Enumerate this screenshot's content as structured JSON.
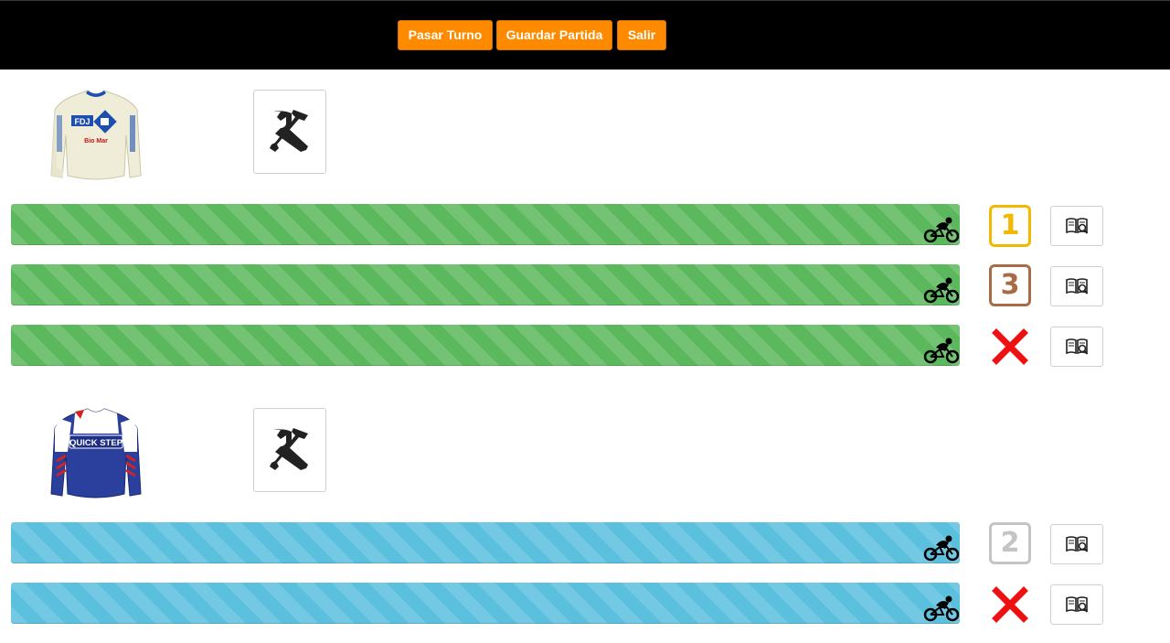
{
  "toolbar": {
    "buttons": [
      "Pasar Turno",
      "Guardar Partida",
      "Salir"
    ],
    "button_color": "#ff8a00"
  },
  "teams": [
    {
      "jersey_icon": "team-jersey-fdj",
      "jersey_text": [
        "FDJ",
        "Bio Mar"
      ],
      "progress_color": "#5cb85c",
      "riders": [
        {
          "progress": 1.0,
          "result": "1",
          "result_color": "#f5b800"
        },
        {
          "progress": 1.0,
          "result": "3",
          "result_color": "#a86b46"
        },
        {
          "progress": 1.0,
          "result": "abandoned",
          "result_color": "#ee1111"
        }
      ]
    },
    {
      "jersey_icon": "team-jersey-quickstep",
      "jersey_text": [
        "QUICK STEP"
      ],
      "progress_color": "#5bc0de",
      "riders": [
        {
          "progress": 1.0,
          "result": "2",
          "result_color": "#c4c4c4"
        },
        {
          "progress": 1.0,
          "result": "abandoned",
          "result_color": "#ee1111"
        }
      ]
    }
  ],
  "icons": {
    "tools": "hammer-wrench-icon",
    "bike": "cyclist-icon",
    "info": "book-search-icon",
    "cross": "cross-icon"
  }
}
